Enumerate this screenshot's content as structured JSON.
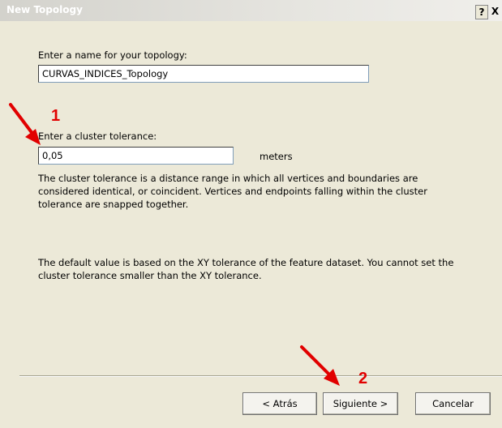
{
  "window": {
    "title": "New Topology",
    "help_label": "?",
    "close_label": "X"
  },
  "name_section": {
    "label": "Enter a name for your topology:",
    "value": "CURVAS_INDICES_Topology"
  },
  "tolerance_section": {
    "label": "Enter a cluster tolerance:",
    "value": "0,05",
    "unit": "meters"
  },
  "descriptions": [
    "The cluster tolerance is a distance range in which all vertices and boundaries are considered identical, or coincident. Vertices and endpoints falling within the cluster tolerance are snapped together.",
    "The default value is based on the XY tolerance of the feature dataset. You cannot set the cluster tolerance smaller than the XY tolerance."
  ],
  "buttons": {
    "back": "< Atrás",
    "next": "Siguiente >",
    "cancel": "Cancelar"
  },
  "annotations": {
    "marker_1": "1",
    "marker_2": "2",
    "color": "#e10000"
  }
}
